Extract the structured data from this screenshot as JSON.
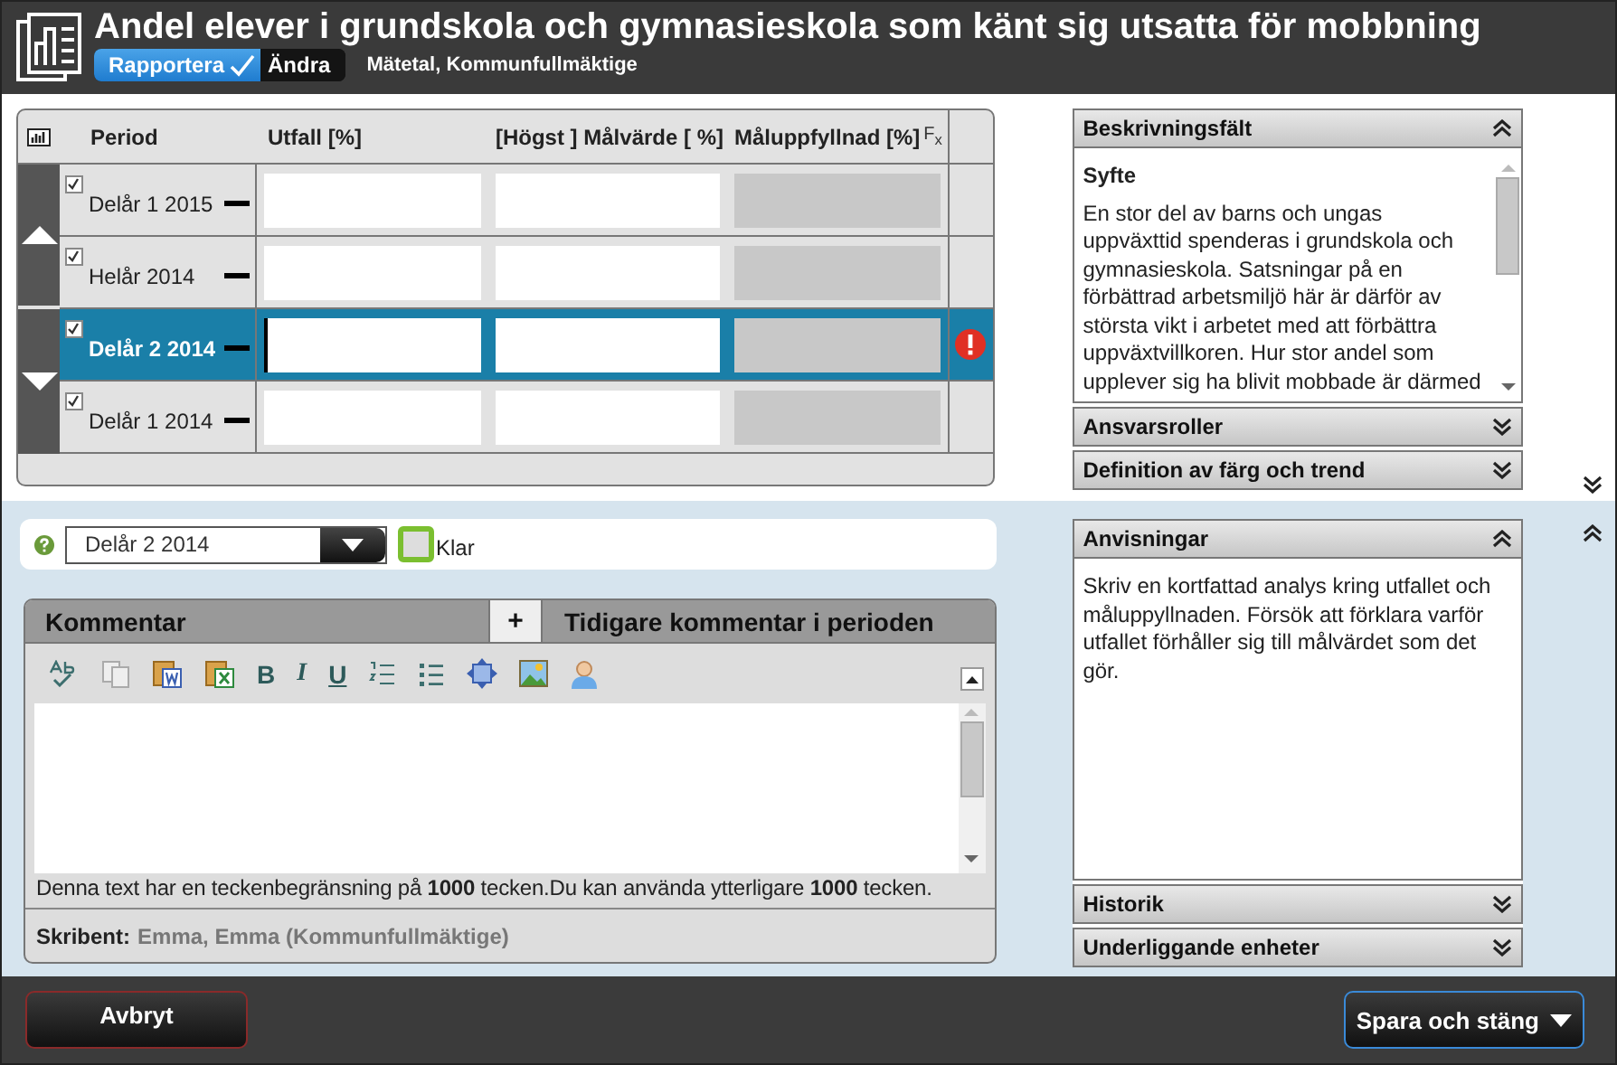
{
  "window": {
    "title": "Andel elever i grundskola och gymnasieskola som känt sig utsatta för mobbning",
    "subtitle": "Mätetal, Kommunfullmäktige"
  },
  "mode_toggle": [
    {
      "label": "Rapportera",
      "selected": true
    },
    {
      "label": "Ändra",
      "selected": false
    }
  ],
  "table": {
    "columns": [
      "Period",
      "Utfall [%]",
      "[Högst ] Målvärde [ %]",
      "Måluppfyllnad [%]"
    ],
    "formula_mark": "F$_{x}$",
    "rows": [
      {
        "period": "Delår 1 2015",
        "checked": true,
        "selected": false,
        "error": false
      },
      {
        "period": "Helår 2014",
        "checked": true,
        "selected": false,
        "error": false
      },
      {
        "period": "Delår 2 2014",
        "checked": true,
        "selected": true,
        "error": true
      },
      {
        "period": "Delår 1 2014",
        "checked": true,
        "selected": false,
        "error": false
      }
    ]
  },
  "panels_top": [
    {
      "title": "Beskrivningsfält",
      "expanded": true,
      "heading": "Syfte",
      "text": "En stor del av barns och ungas uppväxttid spenderas i grundskola och gymnasieskola. Satsningar på en förbättrad arbetsmiljö här är därför av största vikt i arbetet med att förbättra uppväxtvillkoren. Hur stor andel som upplever sig ha blivit mobbade är därmed"
    },
    {
      "title": "Ansvarsroller",
      "expanded": false
    },
    {
      "title": "Definition av färg och trend",
      "expanded": false
    }
  ],
  "panels_bottom": [
    {
      "title": "Anvisningar",
      "expanded": true,
      "text": "Skriv en kortfattad analys kring utfallet och måluppyllnaden. Försök att förklara varför utfallet förhåller sig till målvärdet som det gör."
    },
    {
      "title": "Historik",
      "expanded": false
    },
    {
      "title": "Underliggande enheter",
      "expanded": false
    }
  ],
  "period_select": {
    "value": "Delår 2 2014"
  },
  "done_checkbox": {
    "label": "Klar",
    "checked": false
  },
  "comment": {
    "tab": "Kommentar",
    "add": "+",
    "previous": "Tidigare kommentar i perioden",
    "format_buttons": [
      "B",
      "I",
      "U"
    ],
    "limit_note": "Denna text har en teckenbegränsning på **1000** tecken.Du kan använda ytterligare **1000** tecken.",
    "author_label": "Skribent:",
    "author": "Emma, Emma (Kommunfullmäktige)"
  },
  "buttons": {
    "cancel": "Avbryt",
    "save": "Spara och stäng"
  }
}
